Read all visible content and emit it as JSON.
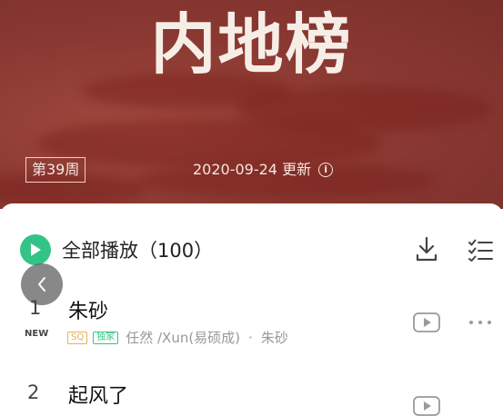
{
  "banner": {
    "title": "内地榜",
    "week": "第39周",
    "update": "2020-09-24 更新"
  },
  "playall": {
    "label": "全部播放（100）"
  },
  "songs": [
    {
      "rank": "1",
      "tag": "NEW",
      "title": "朱砂",
      "quality": "SQ",
      "exclusive": "独家",
      "artists": "任然 /Xun(易硕成)",
      "separator": "·",
      "album": "朱砂"
    },
    {
      "rank": "2",
      "title": "起风了"
    }
  ],
  "icons": [
    "play-icon",
    "download-icon",
    "multi-select-icon",
    "back-icon",
    "mv-icon",
    "more-icon",
    "info-icon"
  ],
  "colors": {
    "accent": "#33c386",
    "banner": "#8c3a33",
    "sq": "#e4b34d"
  }
}
